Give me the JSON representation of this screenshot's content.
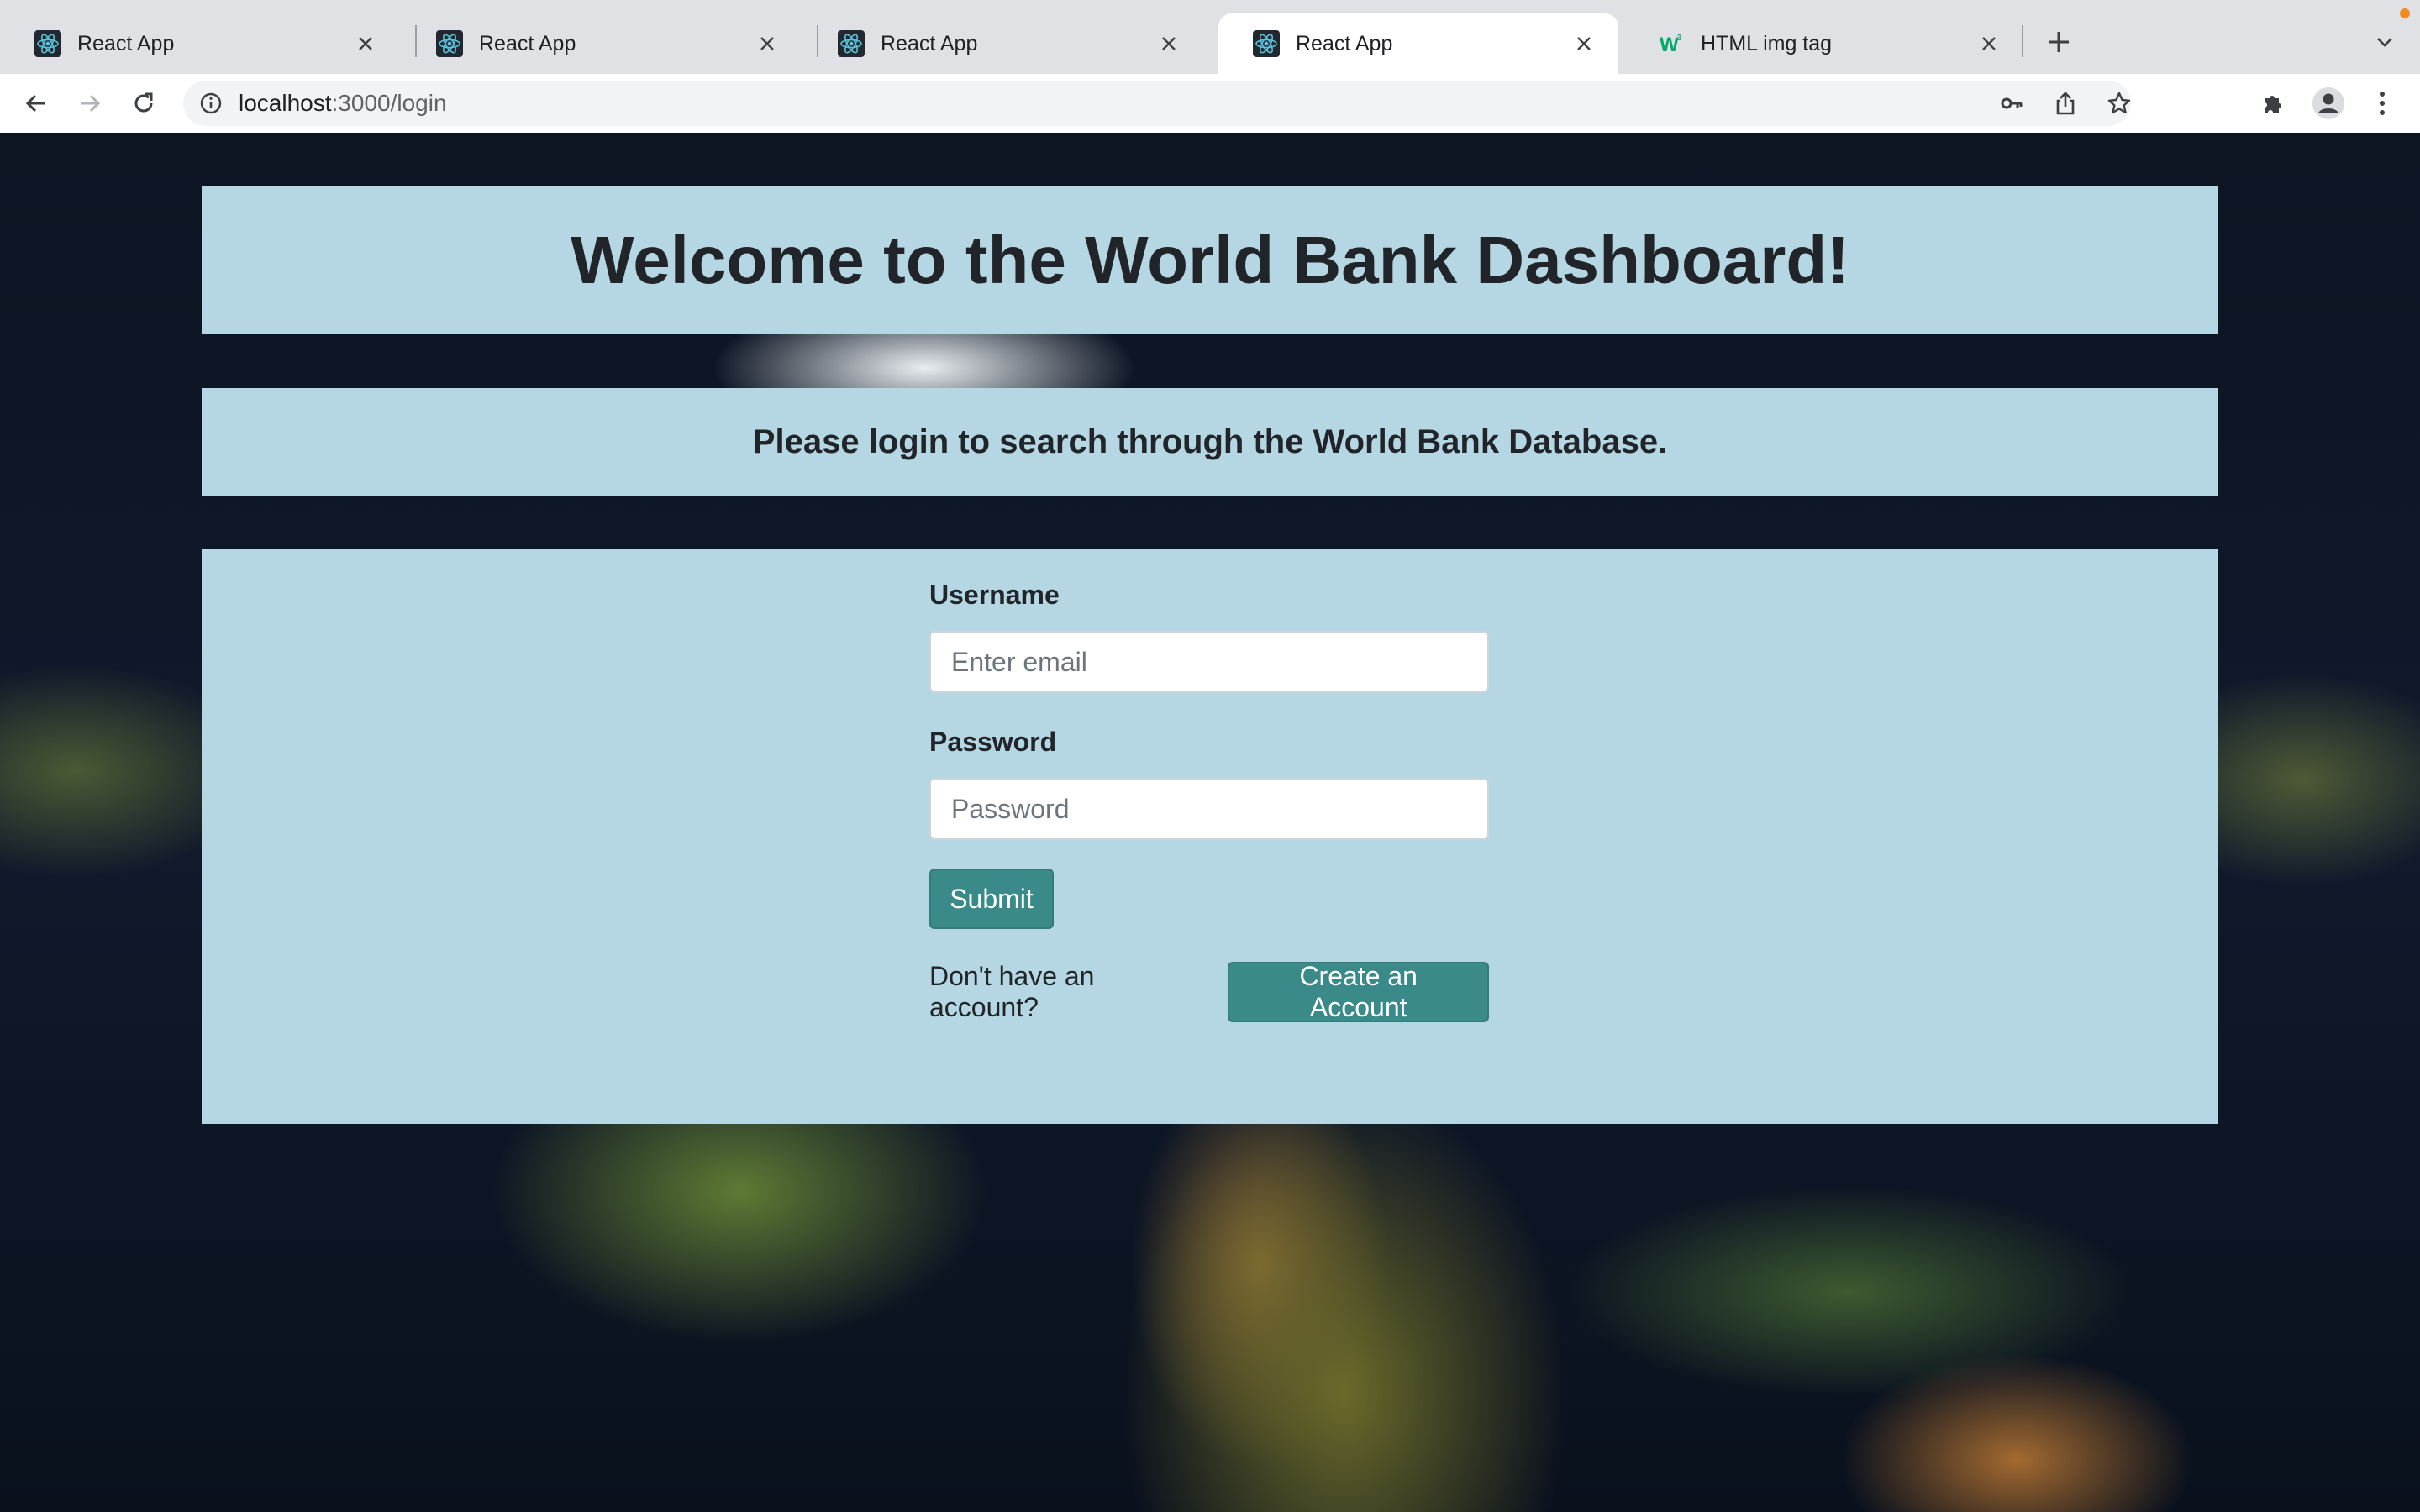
{
  "browser": {
    "tabs": [
      {
        "title": "React App",
        "favicon": "react-icon",
        "active": false
      },
      {
        "title": "React App",
        "favicon": "react-icon",
        "active": false
      },
      {
        "title": "React App",
        "favicon": "react-icon",
        "active": false
      },
      {
        "title": "React App",
        "favicon": "react-icon",
        "active": true
      },
      {
        "title": "HTML img tag",
        "favicon": "w3schools-icon",
        "active": false
      }
    ],
    "url_host": "localhost",
    "url_path": ":3000/login",
    "icons": {
      "back": "back-arrow-icon",
      "forward": "forward-arrow-icon",
      "reload": "reload-icon",
      "info": "info-icon",
      "key": "key-icon",
      "share": "share-icon",
      "bookmark": "star-icon",
      "extensions": "puzzle-icon",
      "profile": "avatar-icon",
      "menu": "kebab-menu-icon"
    }
  },
  "page": {
    "title": "Welcome to the World Bank Dashboard!",
    "subtitle": "Please login to search through the World Bank Database.",
    "form": {
      "username_label": "Username",
      "username_placeholder": "Enter email",
      "password_label": "Password",
      "password_placeholder": "Password",
      "submit_label": "Submit",
      "no_account_text": "Don't have an account?",
      "create_account_label": "Create an Account"
    }
  },
  "colors": {
    "panel": "#b5d7e3",
    "button": "#3a8a8a",
    "text": "#212529"
  }
}
